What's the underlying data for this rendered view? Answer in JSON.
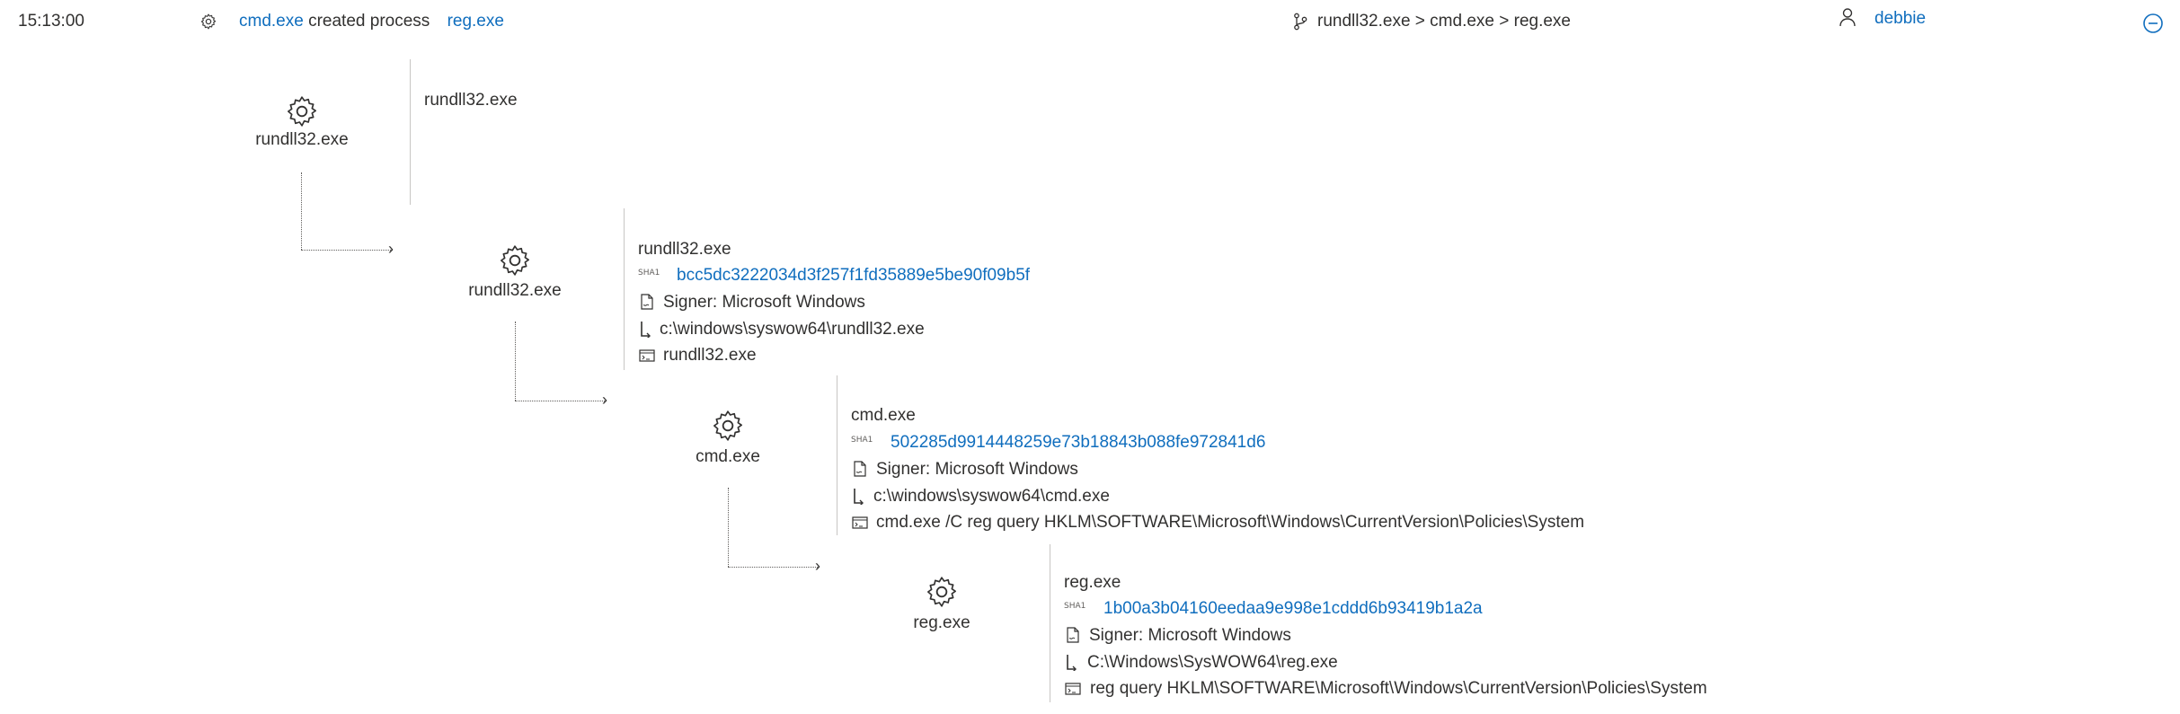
{
  "header": {
    "time": "15:13:00",
    "actor": "cmd.exe",
    "action": "created process",
    "target": "reg.exe",
    "chain": "rundll32.exe > cmd.exe > reg.exe",
    "user": "debbie"
  },
  "nodes": [
    {
      "label": "rundll32.exe",
      "details": {
        "name": "rundll32.exe"
      }
    },
    {
      "label": "rundll32.exe",
      "details": {
        "name": "rundll32.exe",
        "sha1": "bcc5dc3222034d3f257f1fd35889e5be90f09b5f",
        "signer": "Signer: Microsoft Windows",
        "path": "c:\\windows\\syswow64\\rundll32.exe",
        "cmd": "rundll32.exe"
      }
    },
    {
      "label": "cmd.exe",
      "details": {
        "name": "cmd.exe",
        "sha1": "502285d9914448259e73b18843b088fe972841d6",
        "signer": "Signer: Microsoft Windows",
        "path": "c:\\windows\\syswow64\\cmd.exe",
        "cmd": "cmd.exe /C reg query HKLM\\SOFTWARE\\Microsoft\\Windows\\CurrentVersion\\Policies\\System"
      }
    },
    {
      "label": "reg.exe",
      "details": {
        "name": "reg.exe",
        "sha1": "1b00a3b04160eedaa9e998e1cddd6b93419b1a2a",
        "signer": "Signer: Microsoft Windows",
        "path": "C:\\Windows\\SysWOW64\\reg.exe",
        "cmd": "reg query HKLM\\SOFTWARE\\Microsoft\\Windows\\CurrentVersion\\Policies\\System"
      }
    }
  ],
  "icons": {
    "sha_label": "SHA1",
    "gear": "gear-icon",
    "tree": "process-tree-icon",
    "user": "user-icon",
    "collapse": "collapse-icon"
  },
  "colors": {
    "link": "#106ebe",
    "text": "#323130",
    "divider": "#c8c6c4"
  }
}
